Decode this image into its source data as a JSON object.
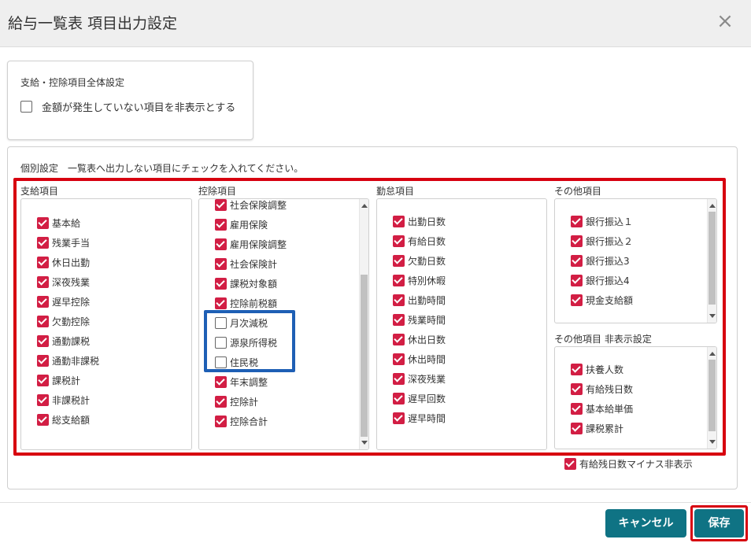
{
  "dialog": {
    "title": "給与一覧表 項目出力設定",
    "close_glyph": "×"
  },
  "global": {
    "title": "支給・控除項目全体設定",
    "hide_zero": {
      "label": "金額が発生していない項目を非表示とする",
      "checked": false
    }
  },
  "individual": {
    "title": "個別設定　一覧表へ出力しない項目にチェックを入れてください。"
  },
  "columns": {
    "payments": {
      "title": "支給項目",
      "items": [
        {
          "label": "基本給",
          "checked": true
        },
        {
          "label": "残業手当",
          "checked": true
        },
        {
          "label": "休日出勤",
          "checked": true
        },
        {
          "label": "深夜残業",
          "checked": true
        },
        {
          "label": "遅早控除",
          "checked": true
        },
        {
          "label": "欠勤控除",
          "checked": true
        },
        {
          "label": "通勤課税",
          "checked": true
        },
        {
          "label": "通勤非課税",
          "checked": true
        },
        {
          "label": "課税計",
          "checked": true
        },
        {
          "label": "非課税計",
          "checked": true
        },
        {
          "label": "総支給額",
          "checked": true
        }
      ]
    },
    "deductions": {
      "title": "控除項目",
      "items": [
        {
          "label": "社会保険調整",
          "checked": true
        },
        {
          "label": "雇用保険",
          "checked": true
        },
        {
          "label": "雇用保険調整",
          "checked": true
        },
        {
          "label": "社会保険計",
          "checked": true
        },
        {
          "label": "課税対象額",
          "checked": true
        },
        {
          "label": "控除前税額",
          "checked": true
        },
        {
          "label": "月次減税",
          "checked": false
        },
        {
          "label": "源泉所得税",
          "checked": false
        },
        {
          "label": "住民税",
          "checked": false
        },
        {
          "label": "年末調整",
          "checked": true
        },
        {
          "label": "控除計",
          "checked": true
        },
        {
          "label": "控除合計",
          "checked": true
        }
      ]
    },
    "attendance": {
      "title": "勤怠項目",
      "items": [
        {
          "label": "出勤日数",
          "checked": true
        },
        {
          "label": "有給日数",
          "checked": true
        },
        {
          "label": "欠勤日数",
          "checked": true
        },
        {
          "label": "特別休暇",
          "checked": true
        },
        {
          "label": "出勤時間",
          "checked": true
        },
        {
          "label": "残業時間",
          "checked": true
        },
        {
          "label": "休出日数",
          "checked": true
        },
        {
          "label": "休出時間",
          "checked": true
        },
        {
          "label": "深夜残業",
          "checked": true
        },
        {
          "label": "遅早回数",
          "checked": true
        },
        {
          "label": "遅早時間",
          "checked": true
        }
      ]
    },
    "other": {
      "title": "その他項目",
      "items": [
        {
          "label": "銀行振込１",
          "checked": true
        },
        {
          "label": "銀行振込２",
          "checked": true
        },
        {
          "label": "銀行振込3",
          "checked": true
        },
        {
          "label": "銀行振込4",
          "checked": true
        },
        {
          "label": "現金支給額",
          "checked": true
        }
      ]
    },
    "other_hidden": {
      "title": "その他項目 非表示設定",
      "items": [
        {
          "label": "扶養人数",
          "checked": true
        },
        {
          "label": "有給残日数",
          "checked": true
        },
        {
          "label": "基本給単価",
          "checked": true
        },
        {
          "label": "課税累計",
          "checked": true
        }
      ]
    }
  },
  "paid_leave_negative": {
    "label": "有給残日数マイナス非表示",
    "checked": true
  },
  "buttons": {
    "cancel": "キャンセル",
    "save": "保存"
  }
}
